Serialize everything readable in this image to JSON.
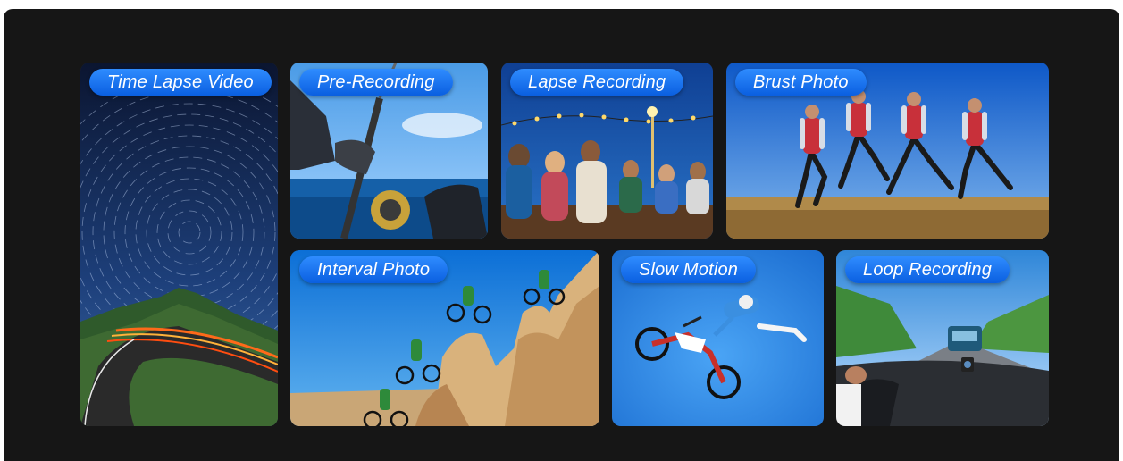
{
  "tiles": [
    {
      "label": "Time Lapse Video"
    },
    {
      "label": "Pre-Recording"
    },
    {
      "label": "Lapse Recording"
    },
    {
      "label": "Brust Photo"
    },
    {
      "label": "Interval Photo"
    },
    {
      "label": "Slow Motion"
    },
    {
      "label": "Loop Recording"
    }
  ],
  "colors": {
    "background": "#161616",
    "pill_top": "#2f8cff",
    "pill_bottom": "#0a5fe0",
    "label_text": "#ffffff"
  }
}
